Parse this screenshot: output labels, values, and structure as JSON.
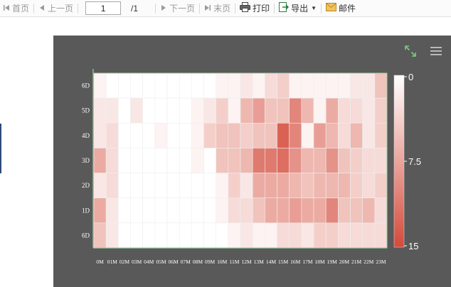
{
  "toolbar": {
    "first": "首页",
    "prev": "上一页",
    "page_value": "1",
    "page_total": "/1",
    "next": "下一页",
    "last": "末页",
    "print": "打印",
    "export": "导出",
    "mail": "邮件"
  },
  "colors": {
    "report_bg": "#595959",
    "cell_low": "#ffffff",
    "cell_high": "#d44a3a",
    "expand_icon": "#7ec87e"
  },
  "icons": {
    "expand": "expand-icon",
    "menu": "hamburger-menu-icon",
    "print": "printer-icon",
    "export": "export-icon",
    "mail": "envelope-icon"
  },
  "chart_data": {
    "type": "heatmap",
    "x_labels": [
      "0M",
      "01M",
      "02M",
      "03M",
      "04M",
      "05M",
      "06M",
      "07M",
      "08M",
      "09M",
      "10M",
      "11M",
      "12M",
      "13M",
      "14M",
      "15M",
      "16M",
      "17M",
      "18M",
      "19M",
      "20M",
      "21M",
      "22M",
      "23M"
    ],
    "y_labels": [
      "6D",
      "5D",
      "4D",
      "3D",
      "2D",
      "1D",
      "6D"
    ],
    "visual_map": {
      "min": 0,
      "max": 15,
      "labels": [
        "0",
        "7.5",
        "15"
      ]
    },
    "values": [
      [
        1,
        0,
        0,
        0,
        0,
        0,
        0,
        0,
        0,
        0,
        1,
        1,
        2,
        1,
        3,
        4,
        1,
        1,
        1,
        1,
        1,
        2,
        2,
        5
      ],
      [
        2,
        2,
        0,
        2,
        0,
        0,
        0,
        0,
        1,
        2,
        4,
        1,
        6,
        8,
        5,
        5,
        10,
        6,
        1,
        7,
        3,
        3,
        2,
        4
      ],
      [
        2,
        3,
        0,
        0,
        0,
        1,
        0,
        0,
        1,
        4,
        5,
        5,
        4,
        5,
        5,
        13,
        10,
        1,
        8,
        6,
        3,
        6,
        2,
        4
      ],
      [
        7,
        3,
        0,
        0,
        0,
        0,
        0,
        0,
        1,
        0,
        5,
        5,
        6,
        11,
        11,
        12,
        9,
        6,
        6,
        9,
        5,
        4,
        3,
        3
      ],
      [
        2,
        3,
        0,
        0,
        0,
        0,
        0,
        0,
        0,
        0,
        1,
        4,
        2,
        7,
        7,
        7,
        6,
        5,
        6,
        6,
        6,
        4,
        3,
        4
      ],
      [
        7,
        2,
        0,
        0,
        0,
        0,
        0,
        0,
        0,
        0,
        1,
        3,
        3,
        5,
        7,
        7,
        8,
        7,
        7,
        10,
        5,
        5,
        6,
        3
      ],
      [
        5,
        2,
        0,
        0,
        0,
        0,
        0,
        0,
        0,
        0,
        0,
        1,
        2,
        1,
        1,
        3,
        3,
        2,
        4,
        4,
        3,
        3,
        3,
        3
      ]
    ]
  }
}
